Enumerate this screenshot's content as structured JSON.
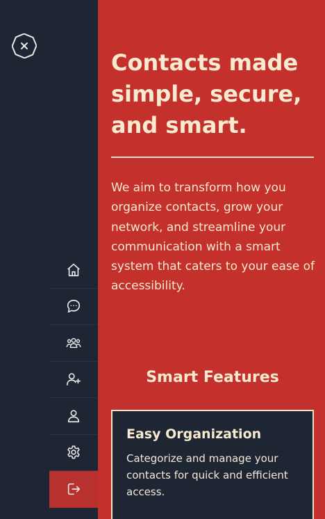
{
  "sidebar": {
    "close_icon": "close-octagon-icon",
    "nav_items": [
      {
        "name": "home",
        "icon": "home-icon"
      },
      {
        "name": "messages",
        "icon": "chat-bubble-icon"
      },
      {
        "name": "groups",
        "icon": "group-icon"
      },
      {
        "name": "add-contact",
        "icon": "user-plus-icon"
      },
      {
        "name": "profile",
        "icon": "user-icon"
      },
      {
        "name": "settings",
        "icon": "gear-icon"
      },
      {
        "name": "logout",
        "icon": "logout-icon",
        "active": true
      }
    ]
  },
  "main": {
    "headline_line1": "Contacts made",
    "headline_line2": "simple, secure,",
    "headline_line3": "and smart.",
    "intro": "We aim to transform how you organize contacts, grow your network, and streamline your communication with a smart system that caters to your ease of accessibility.",
    "features_title": "Smart Features",
    "feature_card": {
      "title": "Easy Organization",
      "description": "Categorize and manage your contacts for quick and efficient access."
    }
  },
  "colors": {
    "sidebar_bg": "#1f2633",
    "main_bg": "#c4302b",
    "active_nav_bg": "#b8312e",
    "cream_text": "#f8ead0"
  }
}
